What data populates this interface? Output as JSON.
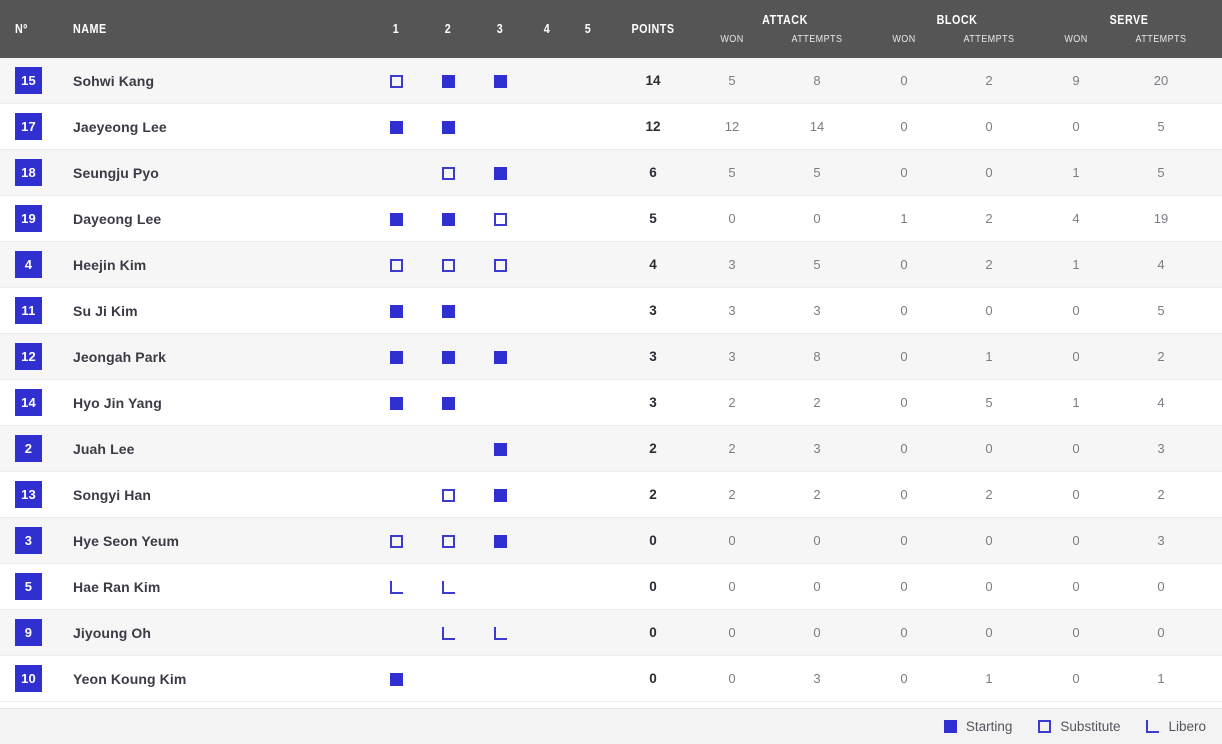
{
  "accent_color": "#2f30cf",
  "header": {
    "background": "#555555",
    "number_label": "Nº",
    "name_label": "NAME",
    "sets": [
      "1",
      "2",
      "3",
      "4",
      "5"
    ],
    "points_label": "POINTS",
    "groups": [
      {
        "title": "ATTACK",
        "won": "WON",
        "attempts": "ATTEMPTS"
      },
      {
        "title": "BLOCK",
        "won": "WON",
        "attempts": "ATTEMPTS"
      },
      {
        "title": "SERVE",
        "won": "WON",
        "attempts": "ATTEMPTS"
      }
    ]
  },
  "players": [
    {
      "number": "15",
      "name": "Sohwi Kang",
      "sets": [
        "sub",
        "start",
        "start",
        "",
        ""
      ],
      "points": "14",
      "attack_won": "5",
      "attack_attempts": "8",
      "block_won": "0",
      "block_attempts": "2",
      "serve_won": "9",
      "serve_attempts": "20"
    },
    {
      "number": "17",
      "name": "Jaeyeong Lee",
      "sets": [
        "start",
        "start",
        "",
        "",
        ""
      ],
      "points": "12",
      "attack_won": "12",
      "attack_attempts": "14",
      "block_won": "0",
      "block_attempts": "0",
      "serve_won": "0",
      "serve_attempts": "5"
    },
    {
      "number": "18",
      "name": "Seungju Pyo",
      "sets": [
        "",
        "sub",
        "start",
        "",
        ""
      ],
      "points": "6",
      "attack_won": "5",
      "attack_attempts": "5",
      "block_won": "0",
      "block_attempts": "0",
      "serve_won": "1",
      "serve_attempts": "5"
    },
    {
      "number": "19",
      "name": "Dayeong Lee",
      "sets": [
        "start",
        "start",
        "sub",
        "",
        ""
      ],
      "points": "5",
      "attack_won": "0",
      "attack_attempts": "0",
      "block_won": "1",
      "block_attempts": "2",
      "serve_won": "4",
      "serve_attempts": "19"
    },
    {
      "number": "4",
      "name": "Heejin Kim",
      "sets": [
        "sub",
        "sub",
        "sub",
        "",
        ""
      ],
      "points": "4",
      "attack_won": "3",
      "attack_attempts": "5",
      "block_won": "0",
      "block_attempts": "2",
      "serve_won": "1",
      "serve_attempts": "4"
    },
    {
      "number": "11",
      "name": "Su Ji Kim",
      "sets": [
        "start",
        "start",
        "",
        "",
        ""
      ],
      "points": "3",
      "attack_won": "3",
      "attack_attempts": "3",
      "block_won": "0",
      "block_attempts": "0",
      "serve_won": "0",
      "serve_attempts": "5"
    },
    {
      "number": "12",
      "name": "Jeongah Park",
      "sets": [
        "start",
        "start",
        "start",
        "",
        ""
      ],
      "points": "3",
      "attack_won": "3",
      "attack_attempts": "8",
      "block_won": "0",
      "block_attempts": "1",
      "serve_won": "0",
      "serve_attempts": "2"
    },
    {
      "number": "14",
      "name": "Hyo Jin Yang",
      "sets": [
        "start",
        "start",
        "",
        "",
        ""
      ],
      "points": "3",
      "attack_won": "2",
      "attack_attempts": "2",
      "block_won": "0",
      "block_attempts": "5",
      "serve_won": "1",
      "serve_attempts": "4"
    },
    {
      "number": "2",
      "name": "Juah Lee",
      "sets": [
        "",
        "",
        "start",
        "",
        ""
      ],
      "points": "2",
      "attack_won": "2",
      "attack_attempts": "3",
      "block_won": "0",
      "block_attempts": "0",
      "serve_won": "0",
      "serve_attempts": "3"
    },
    {
      "number": "13",
      "name": "Songyi Han",
      "sets": [
        "",
        "sub",
        "start",
        "",
        ""
      ],
      "points": "2",
      "attack_won": "2",
      "attack_attempts": "2",
      "block_won": "0",
      "block_attempts": "2",
      "serve_won": "0",
      "serve_attempts": "2"
    },
    {
      "number": "3",
      "name": "Hye Seon Yeum",
      "sets": [
        "sub",
        "sub",
        "start",
        "",
        ""
      ],
      "points": "0",
      "attack_won": "0",
      "attack_attempts": "0",
      "block_won": "0",
      "block_attempts": "0",
      "serve_won": "0",
      "serve_attempts": "3"
    },
    {
      "number": "5",
      "name": "Hae Ran Kim",
      "sets": [
        "lib",
        "lib",
        "",
        "",
        ""
      ],
      "points": "0",
      "attack_won": "0",
      "attack_attempts": "0",
      "block_won": "0",
      "block_attempts": "0",
      "serve_won": "0",
      "serve_attempts": "0"
    },
    {
      "number": "9",
      "name": "Jiyoung Oh",
      "sets": [
        "",
        "lib",
        "lib",
        "",
        ""
      ],
      "points": "0",
      "attack_won": "0",
      "attack_attempts": "0",
      "block_won": "0",
      "block_attempts": "0",
      "serve_won": "0",
      "serve_attempts": "0"
    },
    {
      "number": "10",
      "name": "Yeon Koung Kim",
      "sets": [
        "start",
        "",
        "",
        "",
        ""
      ],
      "points": "0",
      "attack_won": "0",
      "attack_attempts": "3",
      "block_won": "0",
      "block_attempts": "1",
      "serve_won": "0",
      "serve_attempts": "1"
    }
  ],
  "legend": [
    {
      "marker": "start",
      "label": "Starting"
    },
    {
      "marker": "sub",
      "label": "Substitute"
    },
    {
      "marker": "lib",
      "label": "Libero"
    }
  ]
}
